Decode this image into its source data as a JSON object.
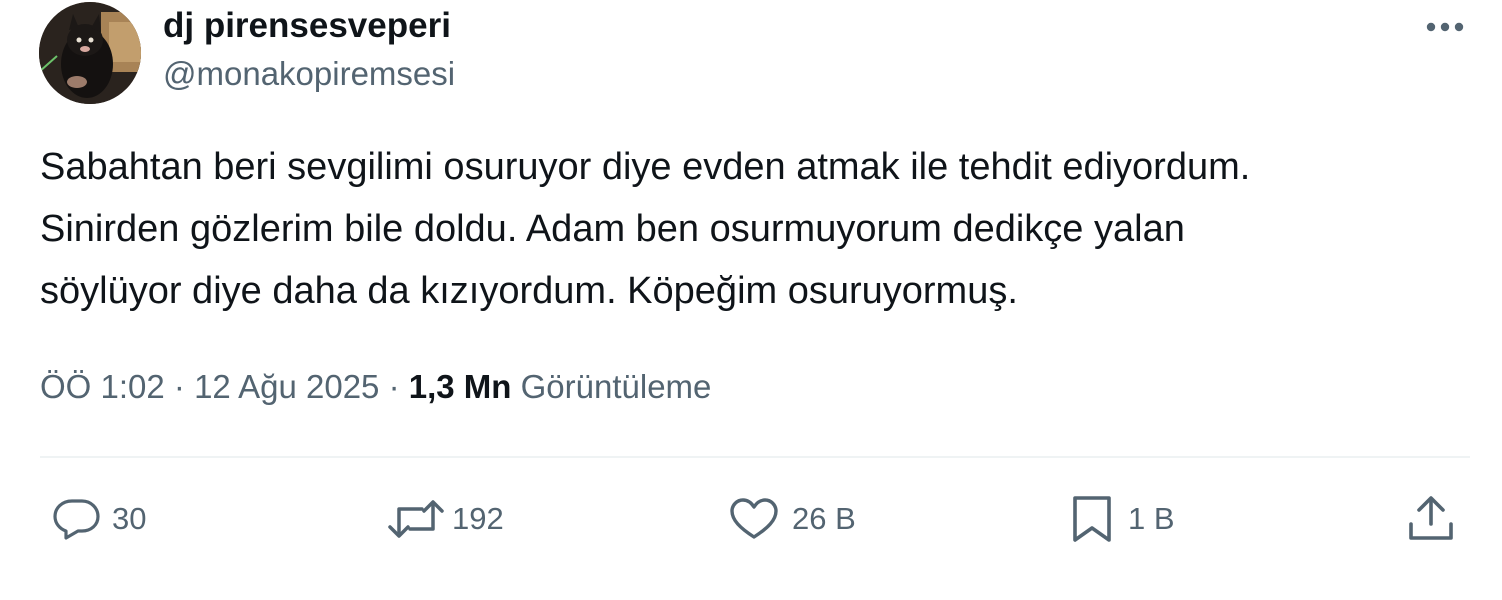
{
  "author": {
    "display_name": "dj pirensesveperi",
    "handle": "@monakopiremsesi"
  },
  "tweet": {
    "text": "Sabahtan beri sevgilimi osuruyor diye evden atmak ile tehdit ediyordum.\nSinirden gözlerim bile doldu. Adam ben osurmuyorum dedikçe yalan\nsöylüyor diye daha da kızıyordum. Köpeğim osuruyormuş."
  },
  "meta": {
    "time": "ÖÖ 1:02",
    "separator": " · ",
    "date": "12 Ağu 2025",
    "views_count": "1,3 Mn",
    "views_label": "Görüntüleme"
  },
  "actions": {
    "reply": {
      "icon": "reply-icon",
      "count": "30"
    },
    "repost": {
      "icon": "repost-icon",
      "count": "192"
    },
    "like": {
      "icon": "heart-icon",
      "count": "26 B"
    },
    "bookmark": {
      "icon": "bookmark-icon",
      "count": "1 B"
    },
    "share": {
      "icon": "share-icon"
    }
  },
  "colors": {
    "text_primary": "#0f1419",
    "text_secondary": "#536471",
    "divider": "#eff3f4"
  }
}
